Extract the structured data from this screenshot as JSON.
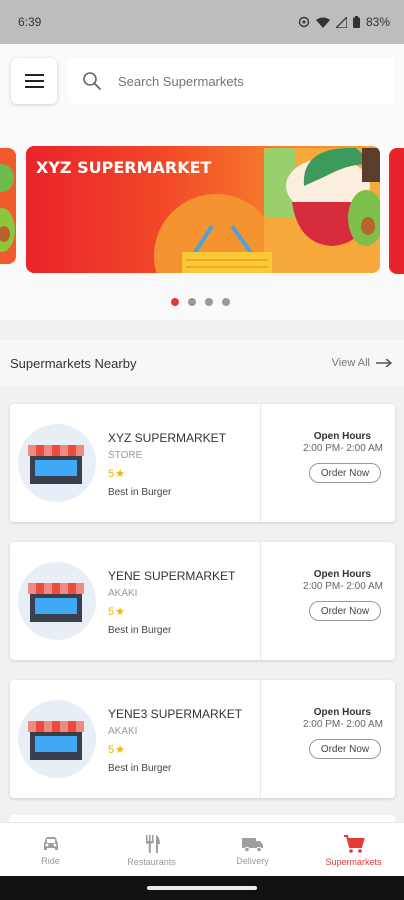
{
  "status_bar": {
    "time": "6:39",
    "battery": "83%"
  },
  "search": {
    "placeholder": "Search Supermarkets"
  },
  "banner": {
    "title": "XYZ SUPERMARKET"
  },
  "section": {
    "title": "Supermarkets Nearby",
    "view_all": "View All"
  },
  "stores": [
    {
      "name": "XYZ SUPERMARKET",
      "category": "STORE",
      "rating": "5",
      "tag": "Best in Burger",
      "hours_title": "Open Hours",
      "hours": "2:00 PM- 2:00 AM",
      "order_label": "Order Now"
    },
    {
      "name": "YENE SUPERMARKET",
      "category": "AKAKI",
      "rating": "5",
      "tag": "Best in Burger",
      "hours_title": "Open Hours",
      "hours": "2:00 PM- 2:00 AM",
      "order_label": "Order Now"
    },
    {
      "name": "YENE3 SUPERMARKET",
      "category": "AKAKI",
      "rating": "5",
      "tag": "Best in Burger",
      "hours_title": "Open Hours",
      "hours": "2:00 PM- 2:00 AM",
      "order_label": "Order Now"
    }
  ],
  "bottom_nav": [
    {
      "label": "Ride",
      "icon": "car-icon"
    },
    {
      "label": "Restaurants",
      "icon": "fork-knife-icon"
    },
    {
      "label": "Delivery",
      "icon": "truck-icon"
    },
    {
      "label": "Supermarkets",
      "icon": "cart-icon",
      "active": true
    }
  ],
  "colors": {
    "accent": "#e53935",
    "star": "#f4b400"
  }
}
